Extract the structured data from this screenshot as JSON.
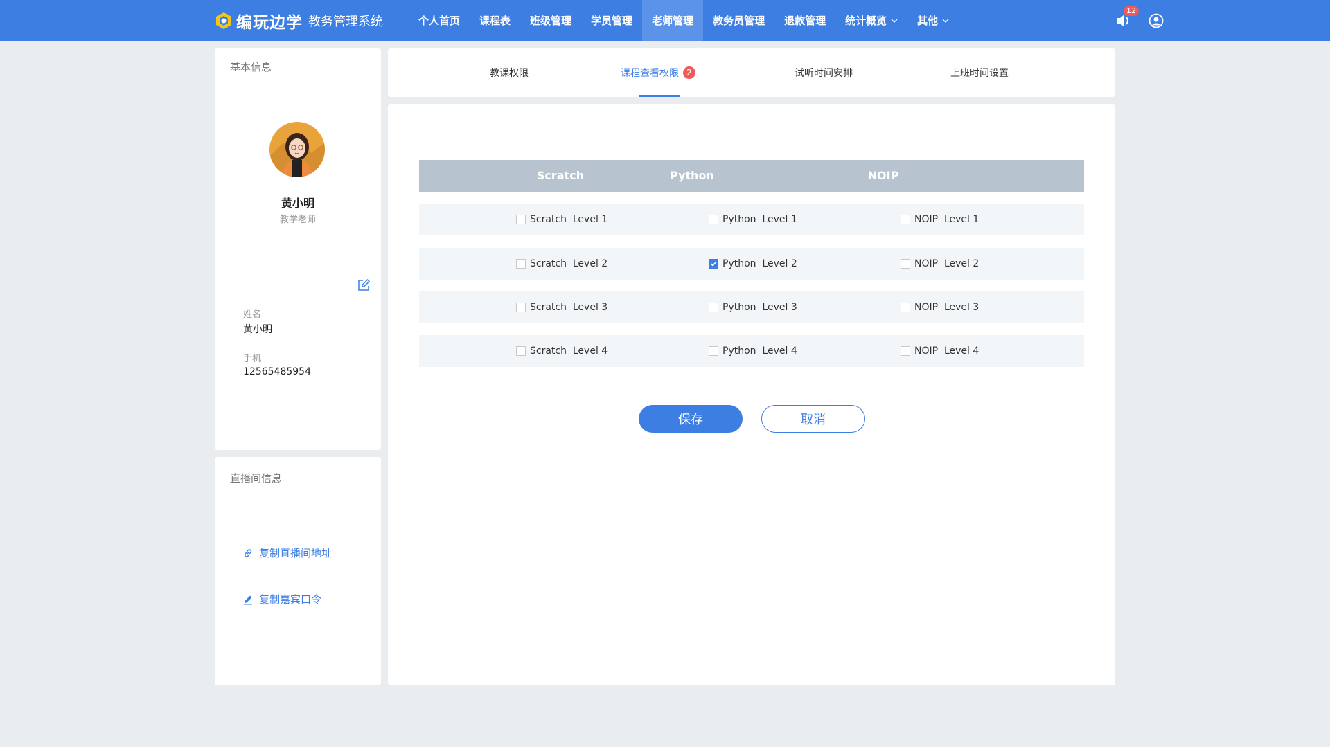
{
  "header": {
    "brand": "编玩边学",
    "subtitle": "教务管理系统",
    "nav": [
      {
        "label": "个人首页"
      },
      {
        "label": "课程表"
      },
      {
        "label": "班级管理"
      },
      {
        "label": "学员管理"
      },
      {
        "label": "老师管理",
        "active": true
      },
      {
        "label": "教务员管理"
      },
      {
        "label": "退款管理"
      },
      {
        "label": "统计概览",
        "dropdown": true
      },
      {
        "label": "其他",
        "dropdown": true
      }
    ],
    "notification_count": "12",
    "icons": [
      "speaker-icon",
      "user-icon"
    ]
  },
  "profile": {
    "section_title": "基本信息",
    "name": "黄小明",
    "role": "教学老师",
    "fields": {
      "name_label": "姓名",
      "name_value": "黄小明",
      "phone_label": "手机",
      "phone_value": "12565485954"
    }
  },
  "live_room": {
    "section_title": "直播间信息",
    "copy_address": "复制直播间地址",
    "copy_guest_code": "复制嘉宾口令"
  },
  "tabs": [
    {
      "label": "教课权限"
    },
    {
      "label": "课程查看权限",
      "badge": "2",
      "active": true
    },
    {
      "label": "试听时间安排"
    },
    {
      "label": "上班时间设置"
    }
  ],
  "table": {
    "columns": [
      "Scratch",
      "Python",
      "NOIP"
    ],
    "rows": [
      [
        {
          "label": "Scratch  Level 1",
          "checked": false
        },
        {
          "label": "Python  Level 1",
          "checked": false
        },
        {
          "label": "NOIP  Level 1",
          "checked": false
        }
      ],
      [
        {
          "label": "Scratch  Level 2",
          "checked": false
        },
        {
          "label": "Python  Level 2",
          "checked": true
        },
        {
          "label": "NOIP  Level 2",
          "checked": false
        }
      ],
      [
        {
          "label": "Scratch  Level 3",
          "checked": false
        },
        {
          "label": "Python  Level 3",
          "checked": false
        },
        {
          "label": "NOIP  Level 3",
          "checked": false
        }
      ],
      [
        {
          "label": "Scratch  Level 4",
          "checked": false
        },
        {
          "label": "Python  Level 4",
          "checked": false
        },
        {
          "label": "NOIP  Level 4",
          "checked": false
        }
      ]
    ]
  },
  "actions": {
    "save": "保存",
    "cancel": "取消"
  },
  "colors": {
    "primary": "#3d7ee3",
    "badge": "#f15a5a",
    "table_header": "#b7c4d0",
    "row_bg": "#f3f6f8"
  }
}
